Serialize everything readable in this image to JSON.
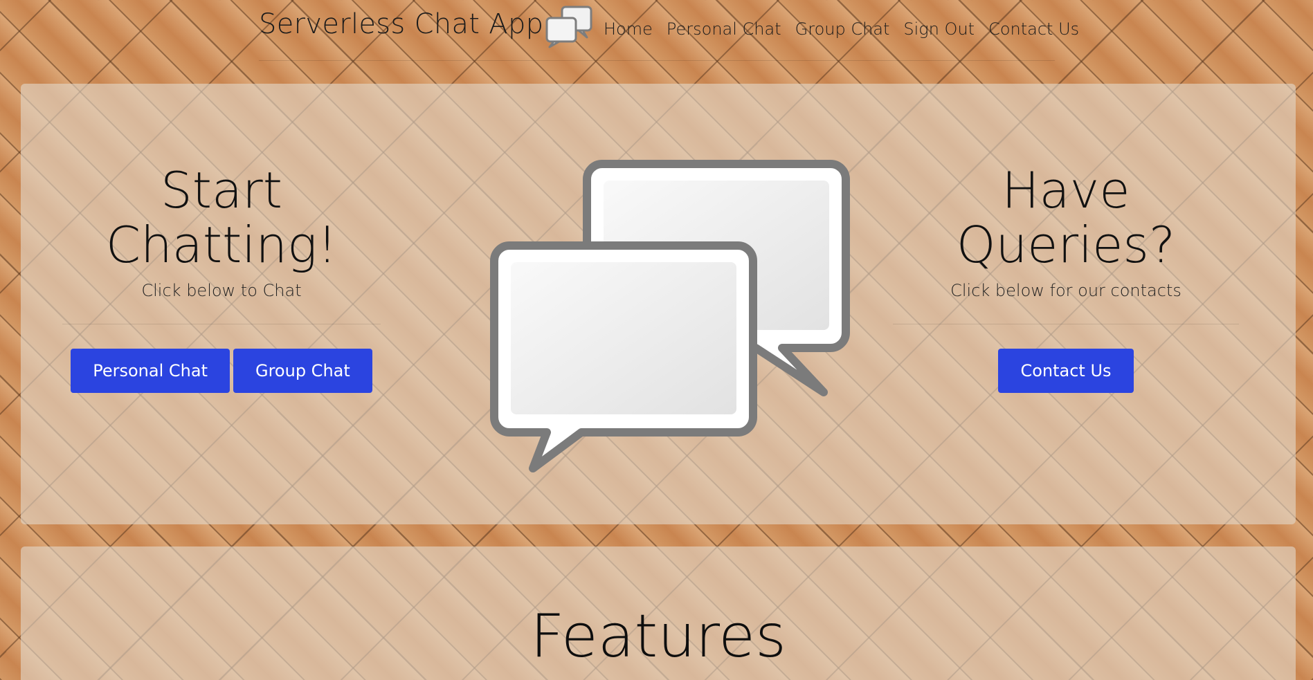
{
  "navbar": {
    "brand": "Serverless Chat App",
    "brand_icon": "chat-bubbles-icon",
    "links": [
      "Home",
      "Personal Chat",
      "Group Chat",
      "Sign Out",
      "Contact Us"
    ]
  },
  "hero": {
    "left": {
      "title": "Start Chatting!",
      "subtitle": "Click below to Chat",
      "buttons": [
        "Personal Chat",
        "Group Chat"
      ]
    },
    "center_image": "chat-bubbles-icon",
    "right": {
      "title": "Have Queries?",
      "subtitle": "Click below for our contacts",
      "button": "Contact Us"
    }
  },
  "features": {
    "title": "Features"
  },
  "colors": {
    "button_bg": "#2b44e0",
    "button_text": "#ffffff",
    "panel_bg": "rgba(226,214,200,0.62)"
  }
}
